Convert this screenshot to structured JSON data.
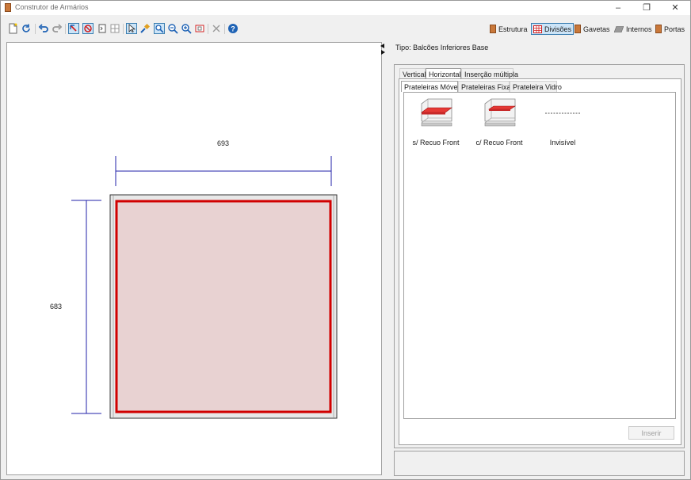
{
  "window": {
    "title": "Construtor de Armários",
    "minimize": "–",
    "maximize": "❐",
    "close": "✕"
  },
  "toolbar": {
    "icons": [
      "new-icon",
      "refresh-icon",
      "undo-icon",
      "redo-icon",
      "select-cabinet-icon",
      "cancel-select-icon",
      "grid-icon",
      "partition-icon",
      "pointer-icon",
      "paint-icon",
      "zoom-window-icon",
      "zoom-out-icon",
      "zoom-in-icon",
      "zoom-extents-icon",
      "delete-icon",
      "help-icon"
    ],
    "right_buttons": [
      {
        "id": "estrutura",
        "label": "Estrutura"
      },
      {
        "id": "divisoes",
        "label": "Divisões"
      },
      {
        "id": "gavetas",
        "label": "Gavetas"
      },
      {
        "id": "internos",
        "label": "Internos"
      },
      {
        "id": "portas",
        "label": "Portas"
      }
    ]
  },
  "drawing": {
    "width_label": "693",
    "height_label": "683"
  },
  "panel": {
    "tipo": "Tipo: Balcões Inferiores Base",
    "tabs": [
      "Vertical",
      "Horizontal",
      "Inserção múltipla"
    ],
    "selected_tab": "Horizontal",
    "subtabs": [
      "Prateleiras Móveis",
      "Prateleiras Fixas",
      "Prateleira Vidro"
    ],
    "selected_subtab": "Prateleiras Móveis",
    "items": [
      {
        "label": "s/ Recuo Front"
      },
      {
        "label": "c/ Recuo Front"
      },
      {
        "label": "Invisível"
      }
    ],
    "insert_label": "Inserir"
  },
  "colors": {
    "accent": "#3c7fb1",
    "shelf_red": "#e53935",
    "dimension_blue": "#2222aa",
    "cabinet_outline": "#d10000"
  }
}
